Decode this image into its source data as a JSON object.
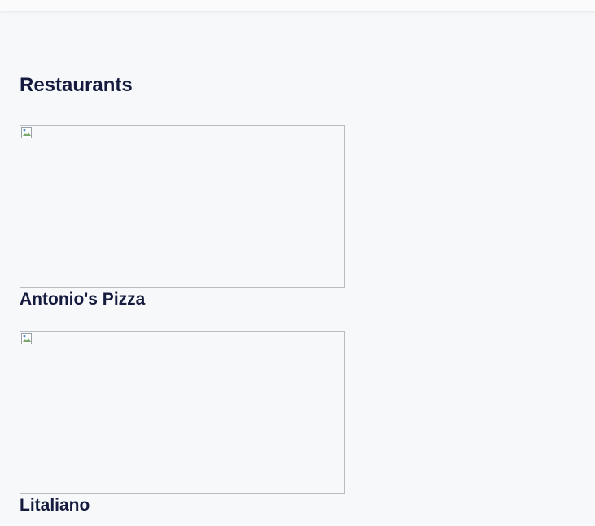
{
  "section": {
    "title": "Restaurants"
  },
  "restaurants": [
    {
      "name": "Antonio's Pizza",
      "image_icon": "broken-image-icon"
    },
    {
      "name": "Litaliano",
      "image_icon": "broken-image-icon"
    }
  ]
}
